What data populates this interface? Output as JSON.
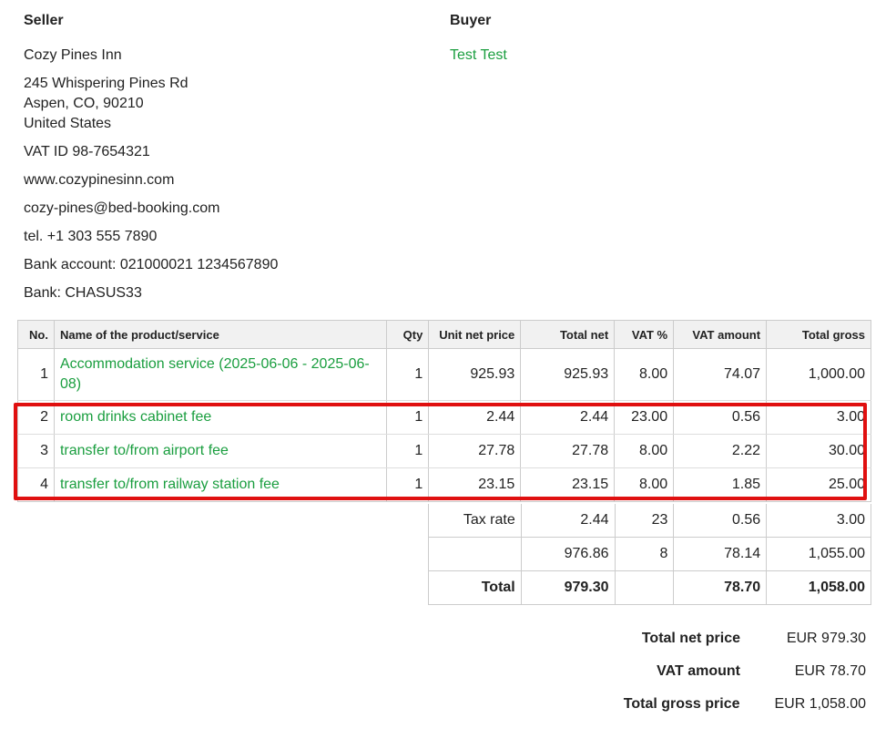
{
  "seller": {
    "heading": "Seller",
    "name": "Cozy Pines Inn",
    "address_line1": "245 Whispering Pines Rd",
    "address_line2": "Aspen, CO, 90210",
    "address_line3": "United States",
    "vat_id": "VAT ID 98-7654321",
    "website": "www.cozypinesinn.com",
    "email": "cozy-pines@bed-booking.com",
    "phone": "tel. +1 303 555 7890",
    "bank_account": "Bank account: 021000021 1234567890",
    "bank": "Bank: CHASUS33"
  },
  "buyer": {
    "heading": "Buyer",
    "name": "Test Test"
  },
  "items_table": {
    "headers": [
      "No.",
      "Name of the product/service",
      "Qty",
      "Unit net price",
      "Total net",
      "VAT %",
      "VAT amount",
      "Total gross"
    ],
    "rows": [
      {
        "no": "1",
        "name": "Accommodation service (2025-06-06 - 2025-06-08)",
        "qty": "1",
        "unit_net": "925.93",
        "total_net": "925.93",
        "vat_pct": "8.00",
        "vat_amount": "74.07",
        "total_gross": "1,000.00"
      },
      {
        "no": "2",
        "name": "room drinks cabinet fee",
        "qty": "1",
        "unit_net": "2.44",
        "total_net": "2.44",
        "vat_pct": "23.00",
        "vat_amount": "0.56",
        "total_gross": "3.00"
      },
      {
        "no": "3",
        "name": "transfer to/from airport fee",
        "qty": "1",
        "unit_net": "27.78",
        "total_net": "27.78",
        "vat_pct": "8.00",
        "vat_amount": "2.22",
        "total_gross": "30.00"
      },
      {
        "no": "4",
        "name": "transfer to/from railway station fee",
        "qty": "1",
        "unit_net": "23.15",
        "total_net": "23.15",
        "vat_pct": "8.00",
        "vat_amount": "1.85",
        "total_gross": "25.00"
      }
    ]
  },
  "summary_table": {
    "rows": [
      {
        "label": "Tax rate",
        "total_net": "2.44",
        "rate": "23",
        "vat_amount": "0.56",
        "total_gross": "3.00"
      },
      {
        "label": "",
        "total_net": "976.86",
        "rate": "8",
        "vat_amount": "78.14",
        "total_gross": "1,055.00"
      },
      {
        "label": "Total",
        "total_net": "979.30",
        "rate": "",
        "vat_amount": "78.70",
        "total_gross": "1,058.00"
      }
    ]
  },
  "totals": {
    "net_label": "Total net price",
    "net_value": "EUR 979.30",
    "vat_label": "VAT amount",
    "vat_value": "EUR 78.70",
    "gross_label": "Total gross price",
    "gross_value": "EUR 1,058.00"
  },
  "colors": {
    "link_green": "#1a9e3f",
    "highlight_red": "#e01010",
    "header_bg": "#f1f1f1"
  }
}
